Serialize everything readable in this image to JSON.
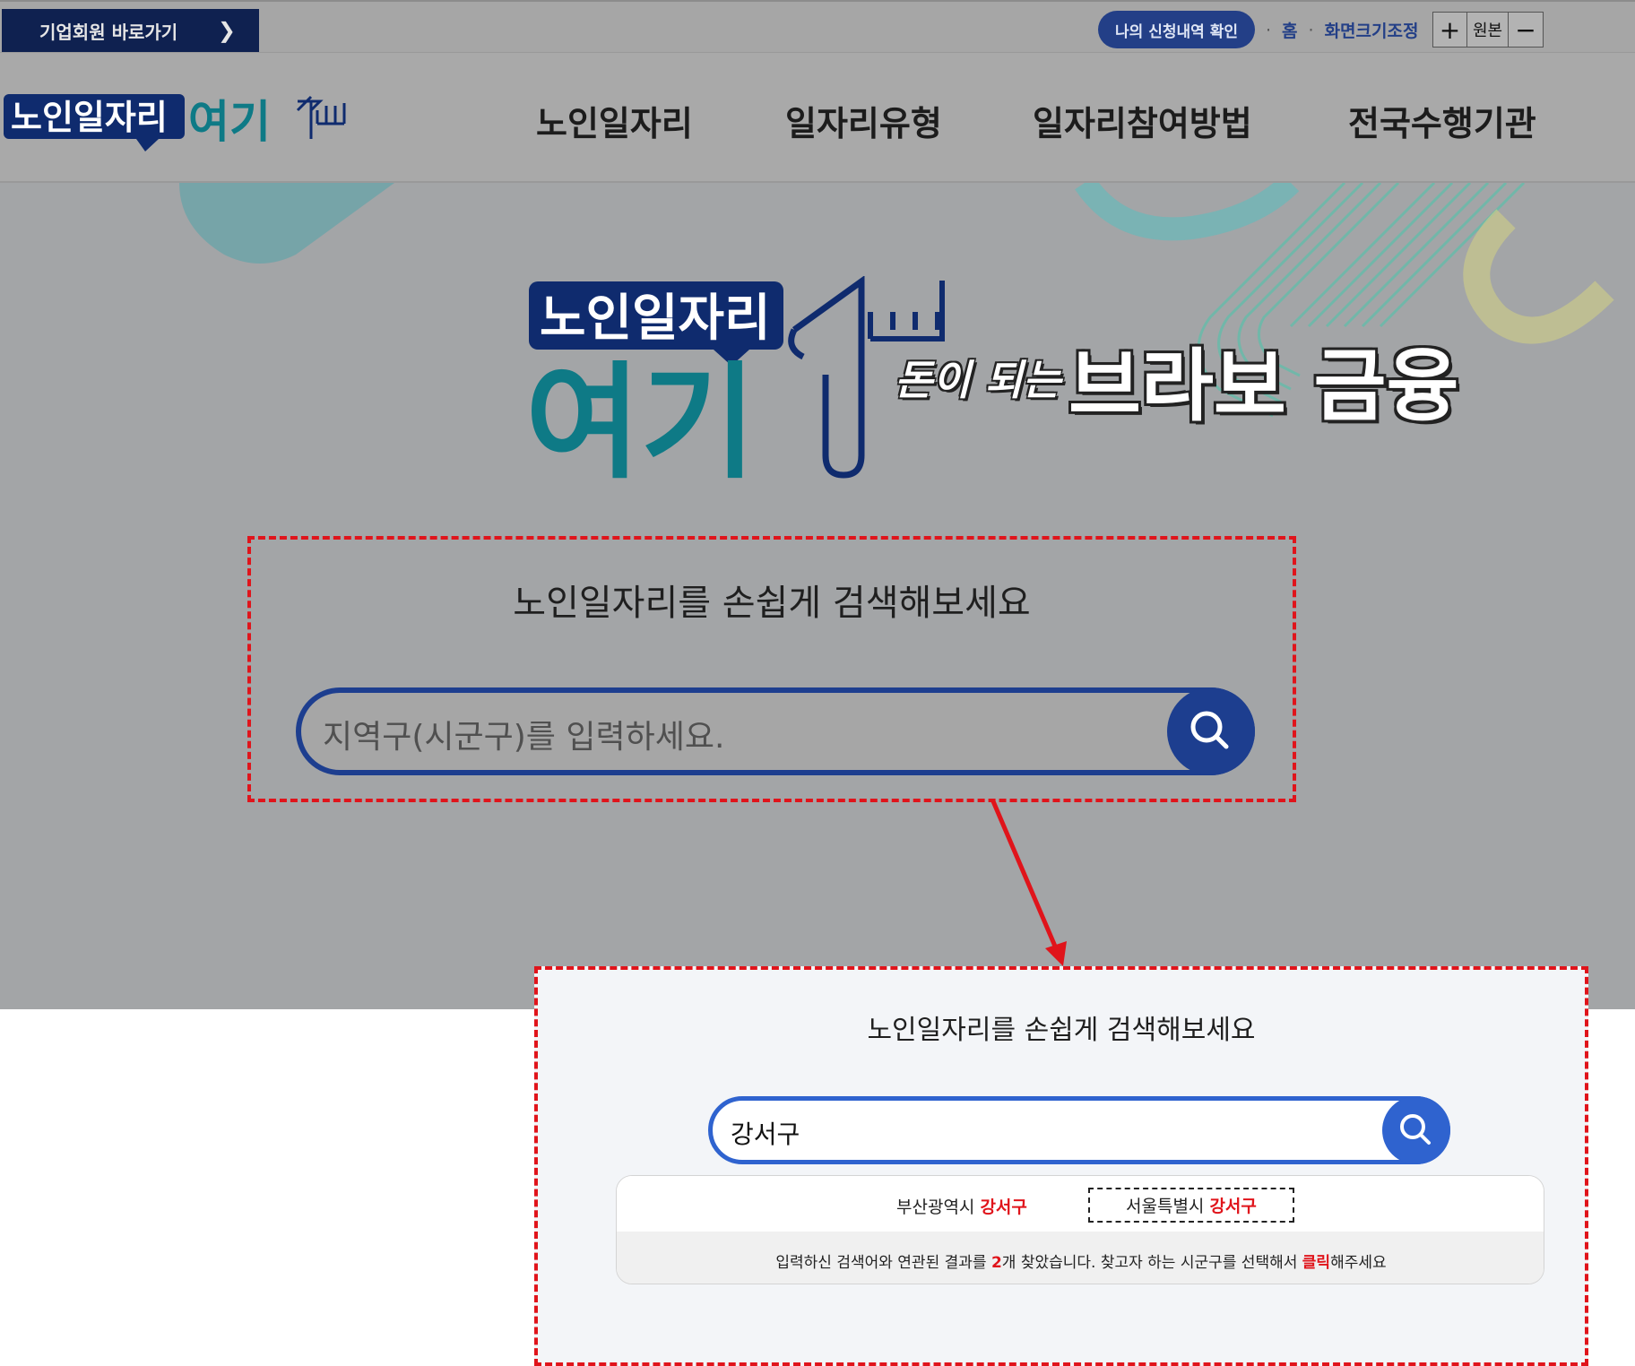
{
  "topbar": {
    "corp_link": "기업회원 바로가기",
    "apply_button": "나의 신청내역 확인",
    "home": "홈",
    "zoom_label": "화면크기조정",
    "zoom_in": "+",
    "zoom_reset": "원본",
    "zoom_out": "−"
  },
  "header": {
    "logo_text": "노인일자리여기",
    "nav": [
      "노인일자리",
      "일자리유형",
      "일자리참여방법",
      "전국수행기관"
    ]
  },
  "hero": {
    "logo_line1": "노인일자리",
    "logo_line2": "여기",
    "tagline_small": "돈이 되는",
    "tagline_big": "브라보 금융"
  },
  "search_before": {
    "title": "노인일자리를 손쉽게 검색해보세요",
    "placeholder": "지역구(시군구)를 입력하세요."
  },
  "search_after": {
    "title": "노인일자리를 손쉽게 검색해보세요",
    "value": "강서구",
    "results": [
      {
        "prefix": "부산광역시",
        "match": "강서구",
        "selected": false
      },
      {
        "prefix": "서울특별시",
        "match": "강서구",
        "selected": true
      }
    ],
    "note_before": "입력하신 검색어와 연관된 결과를 ",
    "note_count": "2",
    "note_middle": "개 찾았습니다. 찾고자 하는 시군구를 선택해서 ",
    "note_click": "클릭",
    "note_after": "해주세요"
  },
  "colors": {
    "navy": "#0f2150",
    "brand_blue": "#1d3e8f",
    "brand_teal": "#0e7a86",
    "search_blue": "#2f63cf",
    "highlight_red": "#e0141b"
  },
  "icons": [
    "chevron-right-icon",
    "search-icon"
  ]
}
